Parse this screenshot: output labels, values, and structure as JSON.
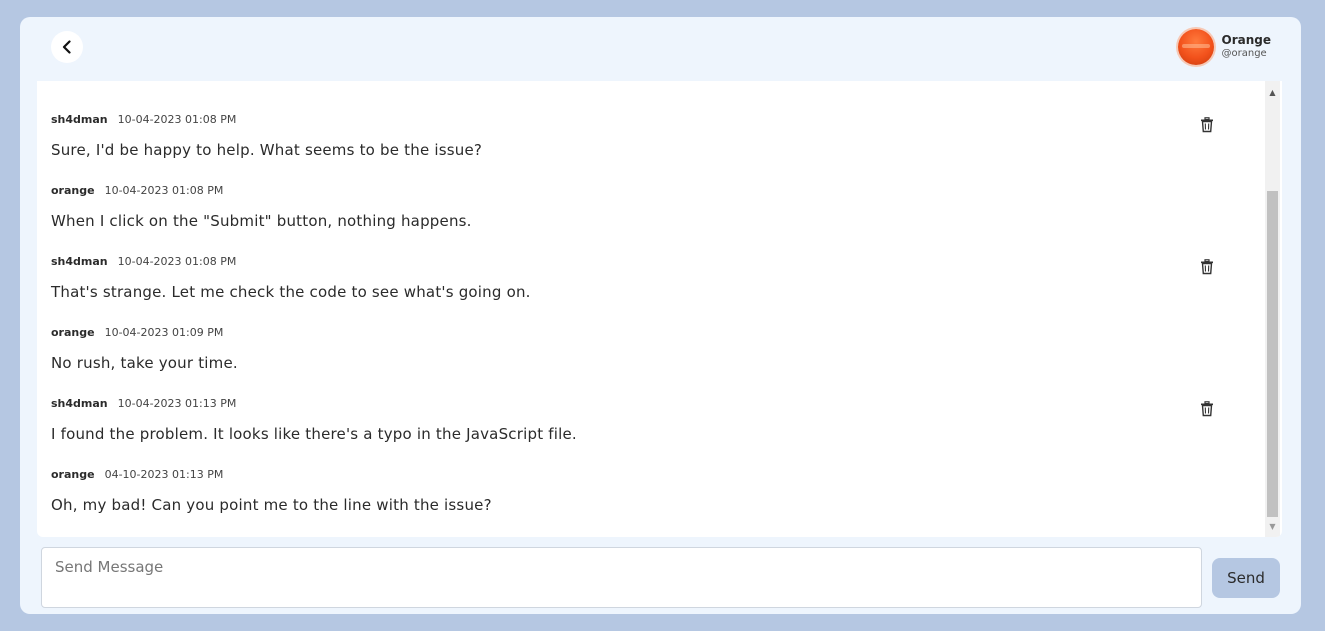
{
  "header": {
    "back_icon": "chevron-left-icon",
    "profile": {
      "name": "Orange",
      "handle": "@orange",
      "avatar_color": "#f2511b"
    }
  },
  "messages": [
    {
      "user": "sh4dman",
      "time": "10-04-2023 01:08 PM",
      "text": "Sure, I'd be happy to help. What seems to be the issue?",
      "deletable": true
    },
    {
      "user": "orange",
      "time": "10-04-2023 01:08 PM",
      "text": "When I click on the \"Submit\" button, nothing happens.",
      "deletable": false
    },
    {
      "user": "sh4dman",
      "time": "10-04-2023 01:08 PM",
      "text": "That's strange. Let me check the code to see what's going on.",
      "deletable": true
    },
    {
      "user": "orange",
      "time": "10-04-2023 01:09 PM",
      "text": "No rush, take your time.",
      "deletable": false
    },
    {
      "user": "sh4dman",
      "time": "10-04-2023 01:13 PM",
      "text": "I found the problem. It looks like there's a typo in the JavaScript file.",
      "deletable": true
    },
    {
      "user": "orange",
      "time": "04-10-2023 01:13 PM",
      "text": "Oh, my bad! Can you point me to the line with the issue?",
      "deletable": false
    }
  ],
  "composer": {
    "placeholder": "Send Message",
    "value": "",
    "send_label": "Send"
  },
  "colors": {
    "background": "#b5c7e2",
    "card": "#eef5fd",
    "send_button": "#b5c7e2"
  }
}
